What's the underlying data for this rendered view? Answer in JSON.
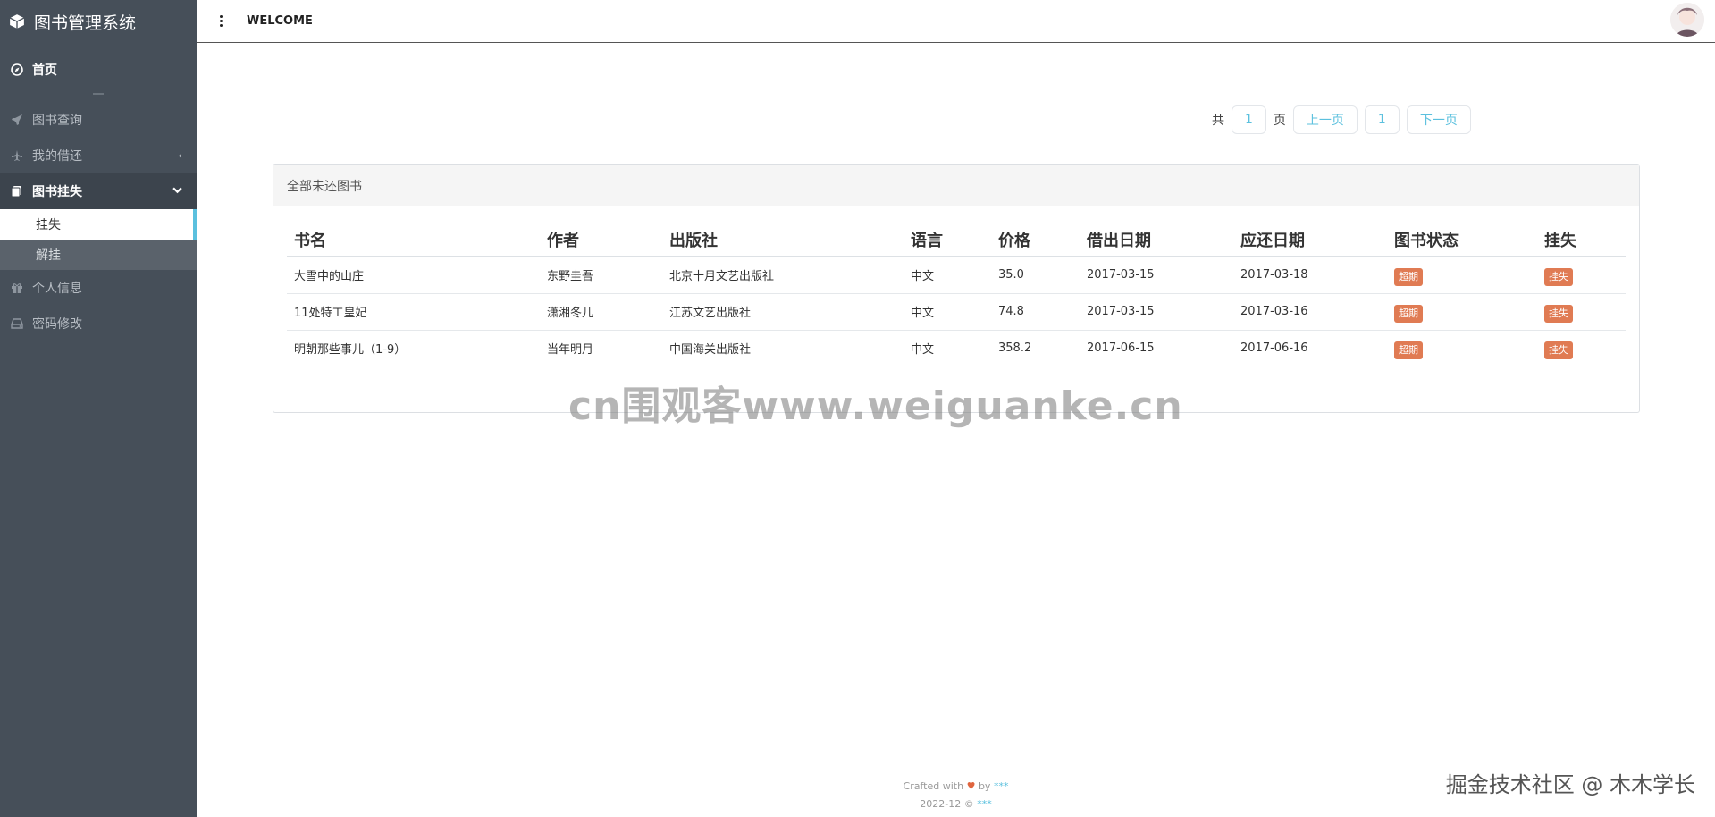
{
  "app": {
    "title": "图书管理系统"
  },
  "sidebar": {
    "home": "首页",
    "items": [
      {
        "label": "图书查询",
        "icon": "rocket-icon"
      },
      {
        "label": "我的借还",
        "icon": "plane-icon"
      },
      {
        "label": "图书挂失",
        "icon": "copy-icon"
      },
      {
        "label": "个人信息",
        "icon": "gift-icon"
      },
      {
        "label": "密码修改",
        "icon": "hdd-icon"
      }
    ],
    "sub_items": [
      {
        "label": "挂失"
      },
      {
        "label": "解挂"
      }
    ]
  },
  "header": {
    "welcome": "WELCOME"
  },
  "pagination": {
    "total_prefix": "共",
    "total_pages": "1",
    "total_suffix": "页",
    "prev": "上一页",
    "current": "1",
    "next": "下一页"
  },
  "panel": {
    "title": "全部未还图书",
    "columns": [
      "书名",
      "作者",
      "出版社",
      "语言",
      "价格",
      "借出日期",
      "应还日期",
      "图书状态",
      "挂失"
    ],
    "rows": [
      {
        "name": "大雪中的山庄",
        "author": "东野圭吾",
        "publisher": "北京十月文艺出版社",
        "lang": "中文",
        "price": "35.0",
        "out": "2017-03-15",
        "due": "2017-03-18",
        "status": "超期",
        "action": "挂失"
      },
      {
        "name": "11处特工皇妃",
        "author": "潇湘冬儿",
        "publisher": "江苏文艺出版社",
        "lang": "中文",
        "price": "74.8",
        "out": "2017-03-15",
        "due": "2017-03-16",
        "status": "超期",
        "action": "挂失"
      },
      {
        "name": "明朝那些事儿（1-9）",
        "author": "当年明月",
        "publisher": "中国海关出版社",
        "lang": "中文",
        "price": "358.2",
        "out": "2017-06-15",
        "due": "2017-06-16",
        "status": "超期",
        "action": "挂失"
      }
    ]
  },
  "watermark": {
    "text": "cn围观客www.weiguanke.cn",
    "corner": "掘金技术社区 @ 木木学长"
  },
  "footer": {
    "crafted": "Crafted with",
    "by": "by",
    "author": "***",
    "year": "2022-12 ©",
    "owner": "***"
  },
  "colors": {
    "sidebar": "#464f59",
    "accent": "#5bc0de",
    "badge": "#e07b53"
  }
}
